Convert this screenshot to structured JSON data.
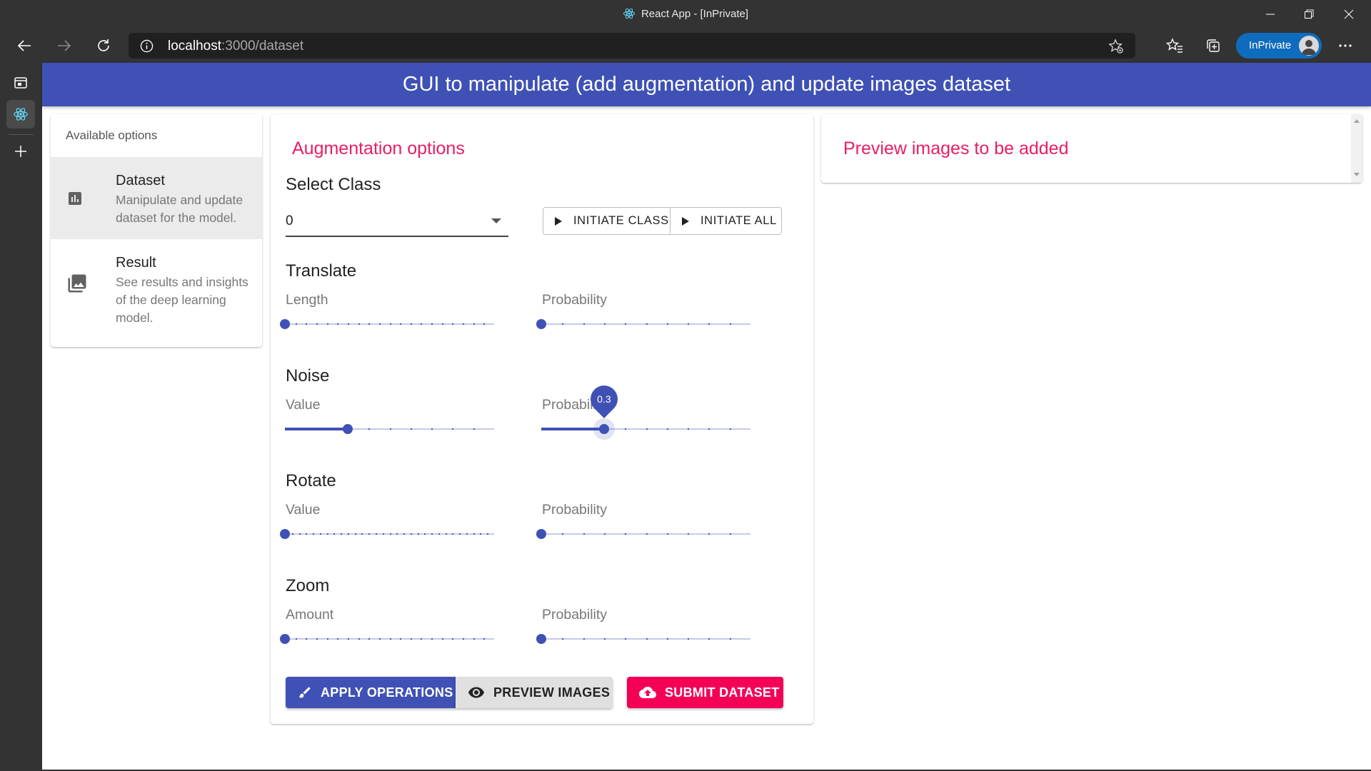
{
  "browser": {
    "window_title": "React App - [InPrivate]",
    "url_host": "localhost",
    "url_path": ":3000/dataset",
    "inprivate_label": "InPrivate"
  },
  "app": {
    "header_title": "GUI to manipulate (add augmentation) and update images dataset",
    "primary_color": "#3f51b5",
    "secondary_color": "#f50057"
  },
  "sidebar": {
    "header": "Available options",
    "items": [
      {
        "title": "Dataset",
        "description": "Manipulate and update dataset for the model.",
        "icon": "bar-chart-icon",
        "selected": true
      },
      {
        "title": "Result",
        "description": "See results and insights of the deep learning model.",
        "icon": "photo-library-icon",
        "selected": false
      }
    ]
  },
  "augmentation": {
    "section_title": "Augmentation options",
    "select_class_label": "Select Class",
    "selected_class": "0",
    "initiate_class_label": "INITIATE CLASS",
    "initiate_all_label": "INITIATE ALL",
    "groups": [
      {
        "title": "Translate",
        "sliders": [
          {
            "label": "Length",
            "value": 0
          },
          {
            "label": "Probability",
            "value": 0
          }
        ]
      },
      {
        "title": "Noise",
        "sliders": [
          {
            "label": "Value",
            "value": 0.3
          },
          {
            "label": "Probability",
            "value": 0.3,
            "active": true,
            "value_label": "0.3"
          }
        ]
      },
      {
        "title": "Rotate",
        "sliders": [
          {
            "label": "Value",
            "value": 0
          },
          {
            "label": "Probability",
            "value": 0
          }
        ]
      },
      {
        "title": "Zoom",
        "sliders": [
          {
            "label": "Amount",
            "value": 0
          },
          {
            "label": "Probability",
            "value": 0
          }
        ]
      }
    ],
    "apply_label": "APPLY OPERATIONS",
    "preview_label": "PREVIEW IMAGES",
    "submit_label": "SUBMIT DATASET"
  },
  "preview": {
    "section_title": "Preview images to be added"
  }
}
